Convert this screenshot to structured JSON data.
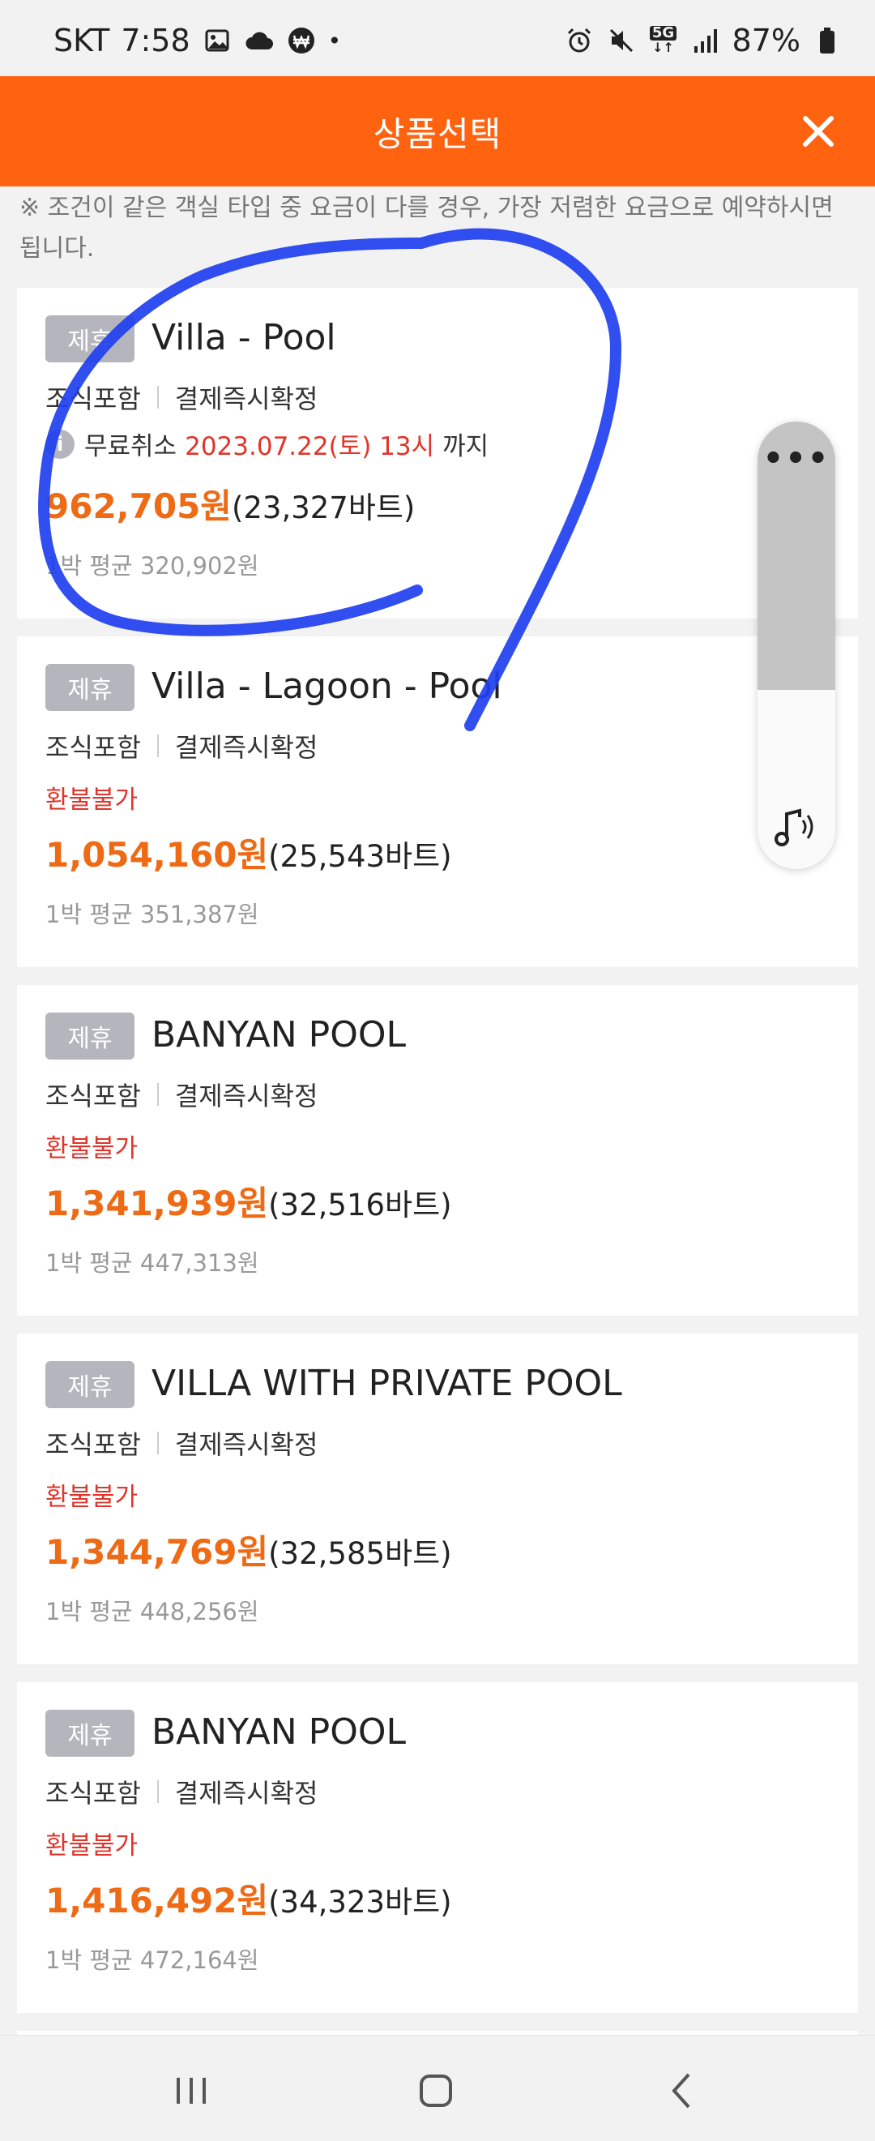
{
  "status_bar": {
    "carrier": "SKT",
    "time": "7:58",
    "network": "5G",
    "battery": "87%"
  },
  "header": {
    "title": "상품선택"
  },
  "notice": "※ 조건이 같은 객실 타입 중 요금이 다를 경우, 가장 저렴한 요금으로 예약하시면 됩니다.",
  "rooms": [
    {
      "badge": "제휴",
      "name": "Villa - Pool",
      "breakfast": "조식포함",
      "payment": "결제즉시확정",
      "cancel_label": "무료취소",
      "cancel_date": "2023.07.22(토) 13시",
      "cancel_until": "까지",
      "price": "962,705원",
      "price_local": "(23,327바트)",
      "avg": "1박 평균 320,902원"
    },
    {
      "badge": "제휴",
      "name": "Villa - Lagoon - Pool",
      "breakfast": "조식포함",
      "payment": "결제즉시확정",
      "refund": "환불불가",
      "price": "1,054,160원",
      "price_local": "(25,543바트)",
      "avg": "1박 평균 351,387원"
    },
    {
      "badge": "제휴",
      "name": "BANYAN POOL",
      "breakfast": "조식포함",
      "payment": "결제즉시확정",
      "refund": "환불불가",
      "price": "1,341,939원",
      "price_local": "(32,516바트)",
      "avg": "1박 평균 447,313원"
    },
    {
      "badge": "제휴",
      "name": "VILLA WITH PRIVATE POOL",
      "breakfast": "조식포함",
      "payment": "결제즉시확정",
      "refund": "환불불가",
      "price": "1,344,769원",
      "price_local": "(32,585바트)",
      "avg": "1박 평균 448,256원"
    },
    {
      "badge": "제휴",
      "name": "BANYAN POOL",
      "breakfast": "조식포함",
      "payment": "결제즉시확정",
      "refund": "환불불가",
      "price": "1,416,492원",
      "price_local": "(34,323바트)",
      "avg": "1박 평균 472,164원"
    }
  ],
  "volume_panel": {
    "level": 0.6,
    "more_label": "•••"
  },
  "colors": {
    "header": "#ff6310",
    "price": "#ee6a15",
    "refund": "#e0352b",
    "badge": "#b5b5be",
    "scribble": "#1f3ff0"
  }
}
